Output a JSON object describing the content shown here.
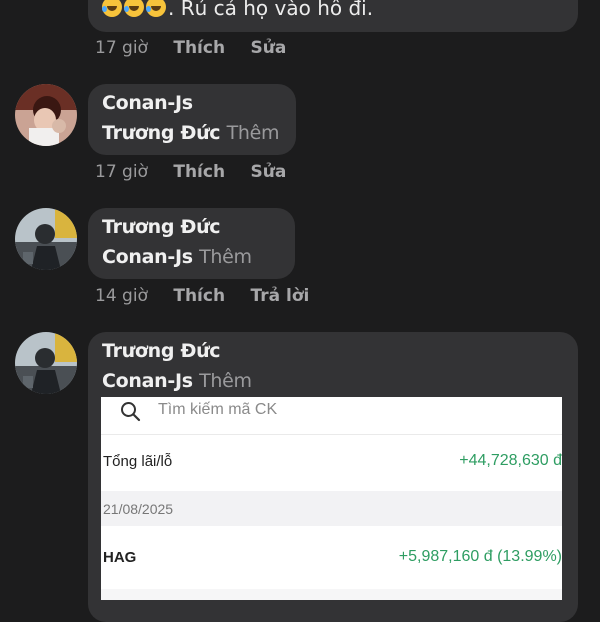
{
  "comments": [
    {
      "text": ". Rủ cả họ vào hô đi.",
      "emoji": [
        "rolling-laughing",
        "rolling-laughing",
        "rolling-laughing"
      ],
      "time": "17 giờ",
      "actions": [
        "Thích",
        "Sửa"
      ]
    },
    {
      "author": "Conan-Js",
      "mention": "Trương Đức",
      "more": "Thêm",
      "time": "17 giờ",
      "actions": [
        "Thích",
        "Sửa"
      ]
    },
    {
      "author": "Trương Đức",
      "mention": "Conan-Js",
      "more": "Thêm",
      "time": "14 giờ",
      "actions": [
        "Thích",
        "Trả lời"
      ]
    },
    {
      "author": "Trương Đức",
      "mention": "Conan-Js",
      "more": "Thêm",
      "attachment": {
        "search_placeholder": "Tìm kiếm mã CK",
        "total_label": "Tổng lãi/lỗ",
        "total_value": "+44,728,630 đ",
        "date": "21/08/2025",
        "stock_code": "HAG",
        "stock_value": "+5,987,160 đ (13.99%)"
      }
    }
  ],
  "colors": {
    "background": "#1c1c1d",
    "bubble": "#333335",
    "meta": "#9a9a9c",
    "gain": "#2e9d62"
  }
}
